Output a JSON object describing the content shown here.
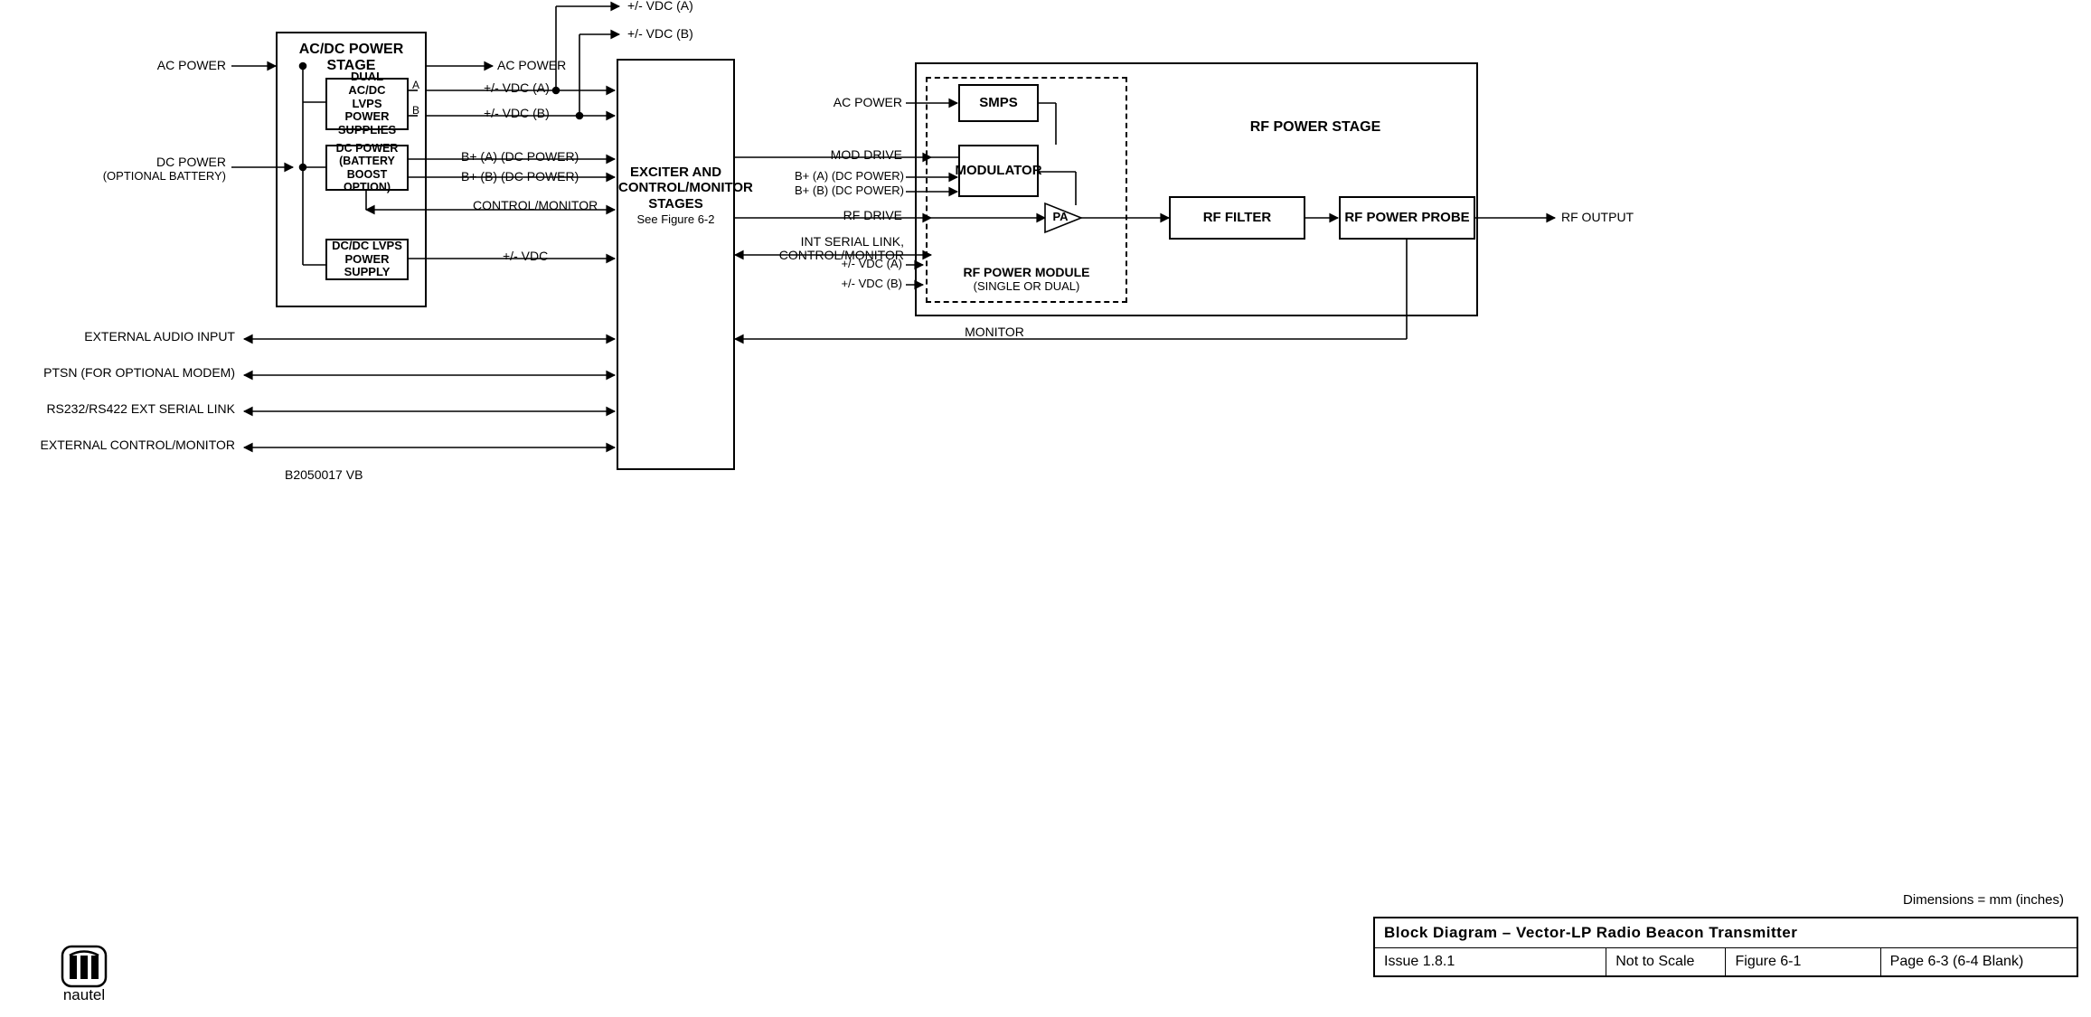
{
  "stages": {
    "acdc_title": "AC/DC POWER STAGE",
    "rf_title": "RF POWER STAGE",
    "rf_module_title": "RF POWER MODULE",
    "rf_module_sub": "(SINGLE OR DUAL)"
  },
  "blocks": {
    "dual_lvps_l1": "DUAL AC/DC",
    "dual_lvps_l2": "LVPS POWER",
    "dual_lvps_l3": "SUPPLIES",
    "dc_boost_l1": "DC POWER",
    "dc_boost_l2": "(BATTERY BOOST",
    "dc_boost_l3": "OPTION)",
    "dcdc_lvps_l1": "DC/DC LVPS",
    "dcdc_lvps_l2": "POWER SUPPLY",
    "exciter_l1": "EXCITER AND",
    "exciter_l2": "CONTROL/MONITOR",
    "exciter_l3": "STAGES",
    "exciter_sub": "See Figure 6-2",
    "smps": "SMPS",
    "modulator": "MODULATOR",
    "pa": "PA",
    "rf_filter": "RF FILTER",
    "rf_probe": "RF POWER PROBE"
  },
  "signals": {
    "ac_power": "AC POWER",
    "dc_power": "DC POWER",
    "dc_power_sub": "(OPTIONAL BATTERY)",
    "ac_power_out": "AC POWER",
    "out_a": "A",
    "out_b": "B",
    "vdc_a": "+/- VDC (A)",
    "vdc_b": "+/- VDC (B)",
    "bplus_a": "B+ (A) (DC POWER)",
    "bplus_b": "B+ (B) (DC POWER)",
    "ctrl_mon": "CONTROL/MONITOR",
    "pm_vdc": "+/- VDC",
    "ext_audio": "EXTERNAL AUDIO INPUT",
    "ptsn": "PTSN (FOR OPTIONAL MODEM)",
    "rs232": "RS232/RS422 EXT SERIAL LINK",
    "ext_ctrl": "EXTERNAL CONTROL/MONITOR",
    "drawing_no": "B2050017  VB",
    "mod_drive": "MOD DRIVE",
    "rf_drive": "RF DRIVE",
    "int_serial_l1": "INT SERIAL LINK,",
    "int_serial_l2": "CONTROL/MONITOR",
    "ac_power_rf": "AC POWER",
    "bplus_a_rf": "B+ (A) (DC POWER)",
    "bplus_b_rf": "B+ (B) (DC POWER)",
    "vdc_a_rf": "+/- VDC (A)",
    "vdc_b_rf": "+/- VDC (B)",
    "monitor": "MONITOR",
    "rf_output": "RF OUTPUT"
  },
  "footer": {
    "dimensions": "Dimensions = mm (inches)",
    "title": "Block Diagram – Vector-LP Radio Beacon Transmitter",
    "issue": "Issue 1.8.1",
    "scale": "Not to Scale",
    "figure": "Figure 6-1",
    "page": "Page 6-3 (6-4 Blank)"
  },
  "logo": "nautel"
}
